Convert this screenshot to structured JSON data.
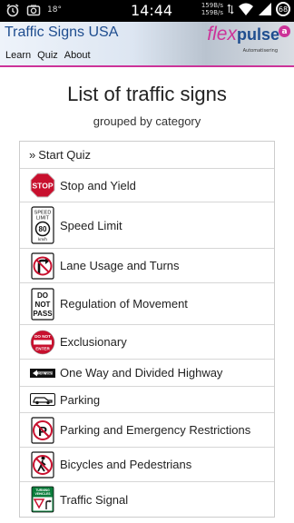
{
  "status_bar": {
    "time": "14:44",
    "notification_text": "18°",
    "speed_up": "159B/s",
    "speed_down": "159B/s",
    "battery": "68"
  },
  "header": {
    "app_title": "Traffic Signs USA",
    "nav": [
      "Learn",
      "Quiz",
      "About"
    ],
    "logo_text_1": "flex",
    "logo_text_2": "pulse",
    "logo_subtext": "Automatisering",
    "logo_badge": "a",
    "accent_color": "#cc3399",
    "title_color": "#1e4d8f"
  },
  "page": {
    "title": "List of traffic signs",
    "subtitle": "grouped by category"
  },
  "start_quiz": {
    "chevron": "»",
    "label": "Start Quiz"
  },
  "categories": [
    {
      "label": "Stop and Yield",
      "icon": "stop-sign-icon",
      "sign_text": "STOP"
    },
    {
      "label": "Speed Limit",
      "icon": "speed-limit-sign-icon",
      "sign_text_1": "SPEED",
      "sign_text_2": "LIMIT",
      "sign_text_3": "80",
      "sign_text_4": "km/h"
    },
    {
      "label": "Lane Usage and Turns",
      "icon": "no-right-turn-sign-icon"
    },
    {
      "label": "Regulation of Movement",
      "icon": "do-not-pass-sign-icon",
      "sign_text_1": "DO",
      "sign_text_2": "NOT",
      "sign_text_3": "PASS"
    },
    {
      "label": "Exclusionary",
      "icon": "do-not-enter-sign-icon",
      "sign_text_1": "DO NOT",
      "sign_text_2": "ENTER"
    },
    {
      "label": "One Way and Divided Highway",
      "icon": "one-way-sign-icon",
      "sign_text": "ONE WAY"
    },
    {
      "label": "Parking",
      "icon": "parking-car-sign-icon"
    },
    {
      "label": "Parking and Emergency Restrictions",
      "icon": "no-parking-sign-icon",
      "sign_text": "P"
    },
    {
      "label": "Bicycles and Pedestrians",
      "icon": "no-pedestrians-sign-icon"
    },
    {
      "label": "Traffic Signal",
      "icon": "turning-vehicles-yield-sign-icon",
      "sign_text_1": "TURNING",
      "sign_text_2": "VEHICLES"
    }
  ]
}
